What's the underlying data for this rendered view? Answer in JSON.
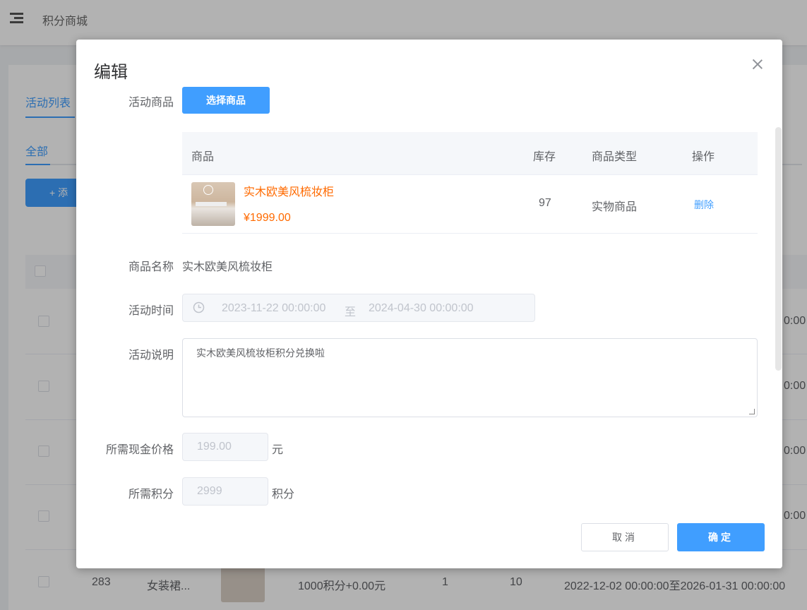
{
  "header": {
    "menu_icon": "menu-fold-icon",
    "title": "积分商城"
  },
  "background": {
    "tabs": [
      "活动列表",
      "全部"
    ],
    "add_button": "+ 添",
    "row": {
      "id": "283",
      "name": "女装裙...",
      "price": "1000积分+0.00元",
      "col1": "1",
      "col2": "10",
      "time": "2022-12-02 00:00:00至2026-01-31 00:00:00"
    },
    "partial_time": "0:00"
  },
  "modal": {
    "title": "编辑",
    "close_icon": "close-icon",
    "product_label": "活动商品",
    "select_button": "选择商品",
    "table": {
      "headers": [
        "商品",
        "库存",
        "商品类型",
        "操作"
      ],
      "rows": [
        {
          "name": "实木欧美风梳妆柜",
          "price": "¥1999.00",
          "stock": "97",
          "type": "实物商品",
          "action": "删除"
        }
      ]
    },
    "name_label": "商品名称",
    "name_value": "实木欧美风梳妆柜",
    "time_label": "活动时间",
    "time_start": "2023-11-22 00:00:00",
    "time_sep": "至",
    "time_end": "2024-04-30 00:00:00",
    "desc_label": "活动说明",
    "desc_value": "实木欧美风梳妆柜积分兑换啦",
    "cash_label": "所需现金价格",
    "cash_value": "199.00",
    "cash_unit": "元",
    "points_label": "所需积分",
    "points_value": "2999",
    "points_unit": "积分",
    "cancel": "取消",
    "confirm": "确定"
  },
  "colors": {
    "primary": "#409eff",
    "price": "#ff6a00"
  }
}
